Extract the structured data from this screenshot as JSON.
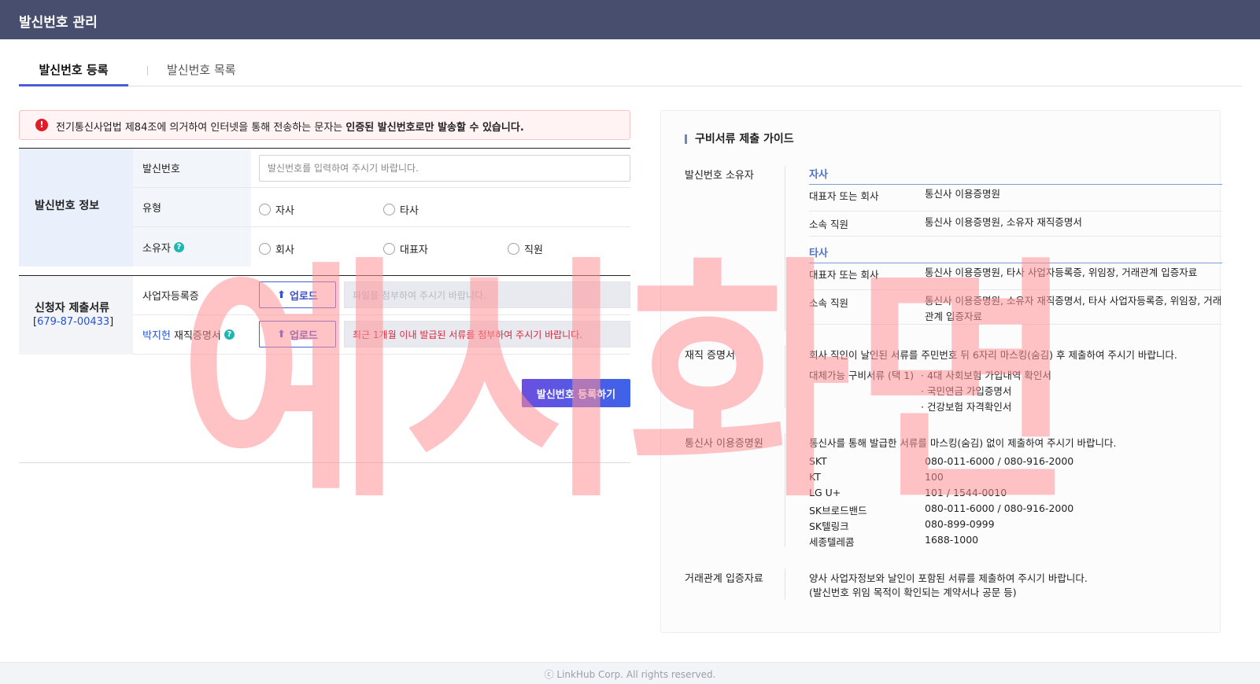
{
  "app": {
    "title": "발신번호 관리"
  },
  "tabs": [
    {
      "label": "발신번호 등록",
      "active": true
    },
    {
      "label": "발신번호 목록",
      "active": false
    }
  ],
  "alert": {
    "text_normal": "전기통신사업법 제84조에 의거하여 인터넷을 통해 전송하는 문자는 ",
    "text_bold": "인증된 발신번호로만 발송할 수 있습니다."
  },
  "info_section": {
    "title": "발신번호 정보",
    "number_label": "발신번호",
    "number_placeholder": "발신번호를 입력하여 주시기 바랍니다.",
    "type_label": "유형",
    "type_options": [
      "자사",
      "타사"
    ],
    "owner_label": "소유자",
    "owner_options": [
      "회사",
      "대표자",
      "직원"
    ]
  },
  "docs_section": {
    "title": "신청자 제출서류",
    "biz_no": "679-87-00433",
    "biz_doc_label": "사업자등록증",
    "employee_name": "박지헌",
    "employ_doc_label": "재직증명서",
    "upload_label": "업로드",
    "file_placeholder": "파일을 첨부하여 주시기 바랍니다.",
    "file_warning": "최근 1개월 이내 발급된 서류를 첨부하여 주시기 바랍니다."
  },
  "submit_label": "발신번호 등록하기",
  "guide": {
    "title": "구비서류 제출 가이드",
    "owner_label": "발신번호 소유자",
    "own": {
      "head": "자사",
      "rows": [
        {
          "k": "대표자 또는 회사",
          "v": "통신사 이용증명원"
        },
        {
          "k": "소속 직원",
          "v": "통신사 이용증명원, 소유자 재직증명서"
        }
      ]
    },
    "other": {
      "head": "타사",
      "rows": [
        {
          "k": "대표자 또는 회사",
          "v": "통신사 이용증명원, 타사 사업자등록증, 위임장, 거래관계 입증자료"
        },
        {
          "k": "소속 직원",
          "v": "통신사 이용증명원, 소유자 재직증명서, 타사 사업자등록증, 위임장, 거래관계 입증자료"
        }
      ]
    },
    "employ": {
      "label": "재직 증명서",
      "note": "회사 직인이 날인된 서류를 주민번호 뒤 6자리 마스킹(숨김) 후 제출하여 주시기 바랍니다.",
      "alt_label": "대체가능 구비서류 (택 1)",
      "alts": [
        "4대 사회보험 가입내역 확인서",
        "국민연금 가입증명서",
        "건강보험 자격확인서"
      ]
    },
    "telecom": {
      "label": "통신사 이용증명원",
      "note": "통신사를 통해 발급한 서류를 마스킹(숨김) 없이 제출하여 주시기 바랍니다.",
      "carriers": [
        {
          "name": "SKT",
          "tel": "080-011-6000 / 080-916-2000"
        },
        {
          "name": "KT",
          "tel": "100"
        },
        {
          "name": "LG U+",
          "tel": "101 / 1544-0010"
        },
        {
          "name": "SK브로드밴드",
          "tel": "080-011-6000 / 080-916-2000"
        },
        {
          "name": "SK텔링크",
          "tel": "080-899-0999"
        },
        {
          "name": "세종텔레콤",
          "tel": "1688-1000"
        }
      ]
    },
    "trade": {
      "label": "거래관계 입증자료",
      "line1": "양사 사업자정보와 날인이 포함된 서류를 제출하여 주시기 바랍니다.",
      "line2": "(발신번호 위임 목적이 확인되는 계약서나 공문 등)"
    }
  },
  "watermark": {
    "text": "예시화면",
    "color": "#ff8f96"
  },
  "footer": "ⓒ LinkHub Corp. All rights reserved."
}
